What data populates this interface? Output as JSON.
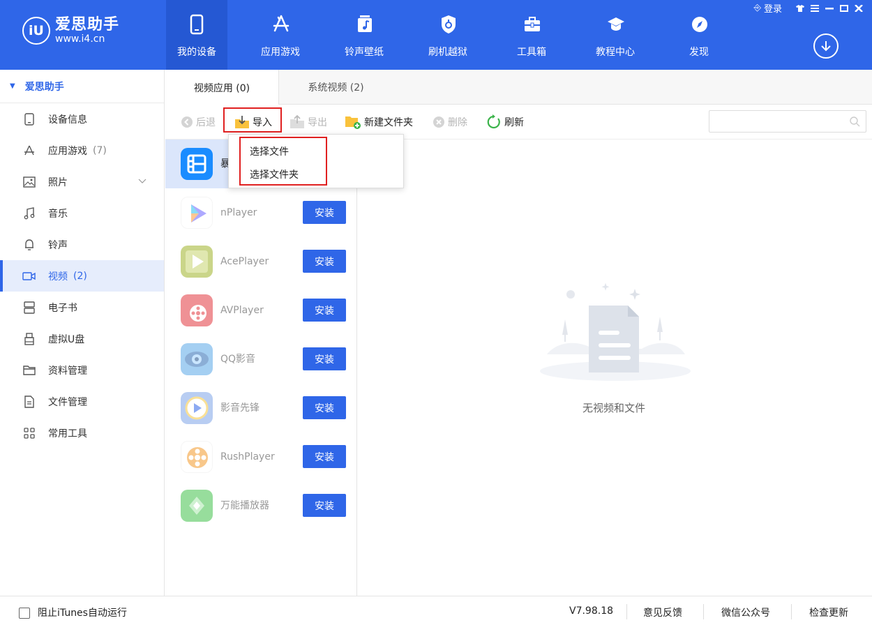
{
  "topbar": {
    "logo_title": "爱思助手",
    "logo_url": "www.i4.cn",
    "logo_letters": "iU",
    "nav": [
      {
        "label": "我的设备",
        "icon": "phone-icon",
        "active": true
      },
      {
        "label": "应用游戏",
        "icon": "appstore-icon",
        "active": false
      },
      {
        "label": "铃声壁纸",
        "icon": "music-note-icon",
        "active": false
      },
      {
        "label": "刷机越狱",
        "icon": "shield-icon",
        "active": false
      },
      {
        "label": "工具箱",
        "icon": "toolbox-icon",
        "active": false
      },
      {
        "label": "教程中心",
        "icon": "graduation-cap-icon",
        "active": false
      },
      {
        "label": "发现",
        "icon": "compass-icon",
        "active": false
      }
    ],
    "login_label": "登录"
  },
  "sidebar": {
    "header": "爱思助手",
    "items": [
      {
        "label": "设备信息",
        "count": "",
        "icon": "device-info-icon"
      },
      {
        "label": "应用游戏",
        "count": "(7)",
        "icon": "appstore-icon"
      },
      {
        "label": "照片",
        "count": "",
        "icon": "photo-icon"
      },
      {
        "label": "音乐",
        "count": "",
        "icon": "music-icon"
      },
      {
        "label": "铃声",
        "count": "",
        "icon": "bell-icon"
      },
      {
        "label": "视频",
        "count": "(2)",
        "icon": "video-icon"
      },
      {
        "label": "电子书",
        "count": "",
        "icon": "ebook-icon"
      },
      {
        "label": "虚拟U盘",
        "count": "",
        "icon": "usb-drive-icon"
      },
      {
        "label": "资料管理",
        "count": "",
        "icon": "folder-icon"
      },
      {
        "label": "文件管理",
        "count": "",
        "icon": "file-icon"
      },
      {
        "label": "常用工具",
        "count": "",
        "icon": "grid-icon"
      }
    ]
  },
  "tabs": [
    {
      "label": "视频应用 (0)",
      "active": true
    },
    {
      "label": "系统视频 (2)",
      "active": false
    }
  ],
  "toolbar": {
    "back": "后退",
    "import": "导入",
    "export": "导出",
    "new_folder": "新建文件夹",
    "delete": "删除",
    "refresh": "刷新"
  },
  "import_menu": {
    "choose_file": "选择文件",
    "choose_folder": "选择文件夹"
  },
  "apps": {
    "selected_partial": "暴",
    "install_label": "安装",
    "items": [
      {
        "name": "nPlayer"
      },
      {
        "name": "AcePlayer"
      },
      {
        "name": "AVPlayer"
      },
      {
        "name": "QQ影音"
      },
      {
        "name": "影音先锋"
      },
      {
        "name": "RushPlayer"
      },
      {
        "name": "万能播放器"
      }
    ]
  },
  "empty_state": {
    "text": "无视频和文件"
  },
  "statusbar": {
    "itunes_block": "阻止iTunes自动运行",
    "version": "V7.98.18",
    "feedback": "意见反馈",
    "wechat": "微信公众号",
    "check_update": "检查更新"
  },
  "colors": {
    "brand": "#2f66e8",
    "highlight": "#e02020"
  }
}
